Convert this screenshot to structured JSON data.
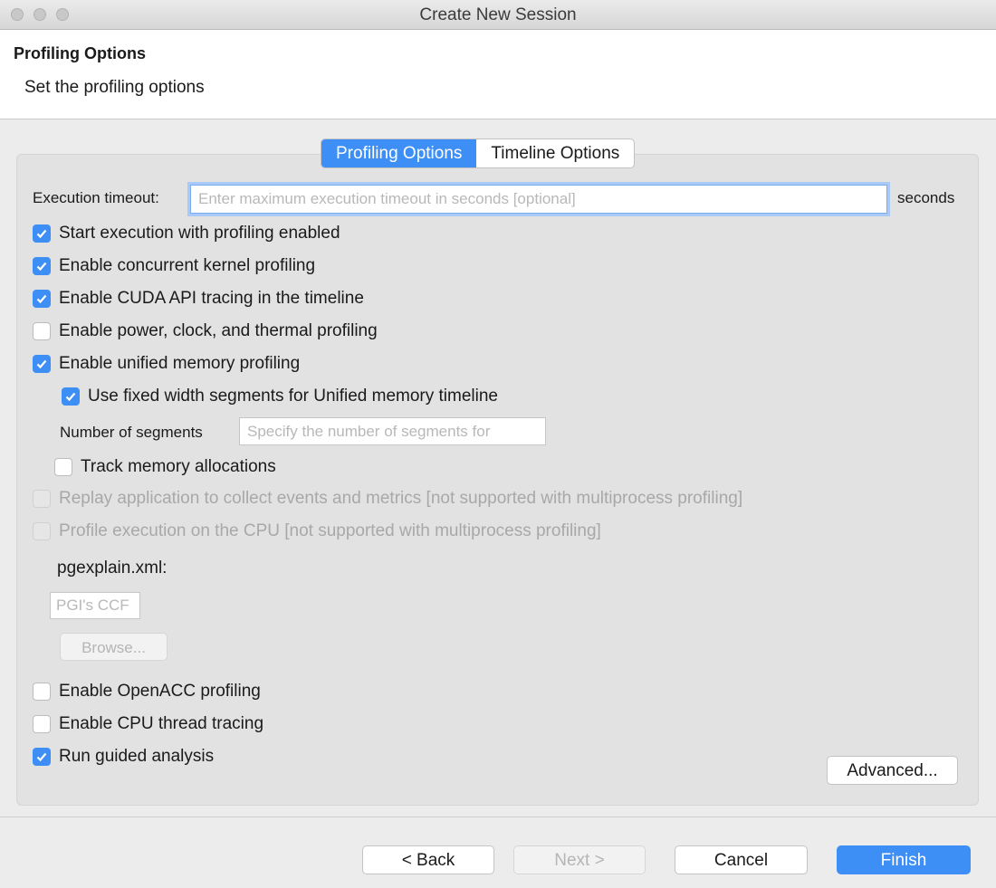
{
  "window": {
    "title": "Create New Session"
  },
  "header": {
    "title": "Profiling Options",
    "description": "Set the profiling options"
  },
  "tabs": [
    {
      "label": "Profiling Options",
      "active": true
    },
    {
      "label": "Timeline Options",
      "active": false
    }
  ],
  "execution_timeout": {
    "label": "Execution timeout:",
    "placeholder": "Enter maximum execution timeout in seconds [optional]",
    "unit": "seconds"
  },
  "options": {
    "start_profiling": {
      "label": "Start execution with profiling enabled",
      "checked": true
    },
    "concurrent_kernel": {
      "label": "Enable concurrent kernel profiling",
      "checked": true
    },
    "cuda_api_tracing": {
      "label": "Enable CUDA API tracing in the timeline",
      "checked": true
    },
    "power_clock_thermal": {
      "label": "Enable power, clock, and thermal profiling",
      "checked": false
    },
    "unified_memory": {
      "label": "Enable unified memory profiling",
      "checked": true
    },
    "fixed_width_segments": {
      "label": "Use fixed width segments for Unified memory timeline",
      "checked": true
    },
    "track_memory": {
      "label": "Track memory allocations",
      "checked": false
    },
    "replay_application": {
      "label": "Replay application to collect events and metrics [not supported with multiprocess profiling]",
      "checked": false,
      "disabled": true
    },
    "profile_cpu": {
      "label": "Profile execution on the CPU [not supported with multiprocess profiling]",
      "checked": false,
      "disabled": true
    },
    "openacc": {
      "label": "Enable OpenACC profiling",
      "checked": false
    },
    "cpu_thread_tracing": {
      "label": "Enable CPU thread tracing",
      "checked": false
    },
    "guided_analysis": {
      "label": "Run guided analysis",
      "checked": true
    }
  },
  "segments": {
    "label": "Number of segments",
    "placeholder": "Specify the number of segments for"
  },
  "pgexplain": {
    "label": "pgexplain.xml:",
    "placeholder": "PGI's CCF",
    "browse_label": "Browse..."
  },
  "advanced_label": "Advanced...",
  "footer": {
    "back_label": "< Back",
    "next_label": "Next >",
    "cancel_label": "Cancel",
    "finish_label": "Finish"
  },
  "colors": {
    "accent": "#3d8ff6"
  }
}
